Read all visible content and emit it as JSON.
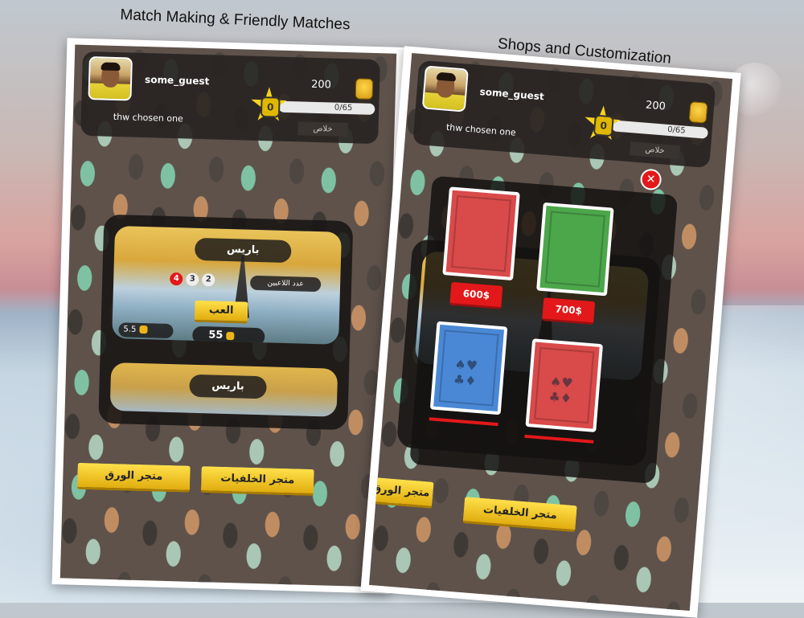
{
  "captions": {
    "left": "Match Making & Friendly Matches",
    "right": "Shops and Customization"
  },
  "profile": {
    "username": "some_guest",
    "title": "thw chosen one",
    "coins": "200",
    "level": "0",
    "xp_text": "0/65",
    "rank": "خلاص"
  },
  "match": {
    "city": "باريس",
    "players_label": "عدد اللاعبين",
    "player_counts": [
      "2",
      "3",
      "4"
    ],
    "play_label": "العب",
    "entry_fee": "5.5",
    "prize": "55",
    "second_city": "باريس"
  },
  "shops": {
    "cards_label": "متجر الورق",
    "backgrounds_label": "متجر الخلفيات"
  },
  "shop_overlay": {
    "prices": [
      "600$",
      "700$"
    ],
    "close_label": "✕",
    "city_behind": "باريس"
  },
  "colors": {
    "accent_yellow": "#f4d21f",
    "price_red": "#e3181a",
    "panel_dark": "#282422"
  }
}
